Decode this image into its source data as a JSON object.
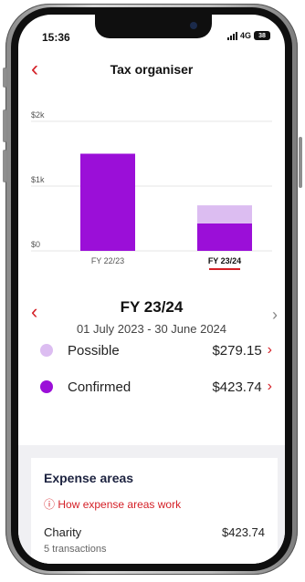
{
  "status_bar": {
    "time": "15:36",
    "network": "4G",
    "battery": "38"
  },
  "header": {
    "title": "Tax organiser",
    "back_icon": "chevron-left-icon"
  },
  "chart_data": {
    "type": "bar",
    "categories": [
      "FY 22/23",
      "FY 23/24"
    ],
    "series": [
      {
        "name": "Confirmed",
        "values": [
          1500,
          423.74
        ]
      },
      {
        "name": "Possible",
        "values": [
          0,
          279.15
        ]
      }
    ],
    "y_ticks": [
      "$0",
      "$1k",
      "$2k"
    ],
    "ylim": [
      0,
      2000
    ],
    "selected_category": "FY 23/24",
    "colors": {
      "confirmed": "#9b0fd8",
      "possible": "#dcbdf1",
      "grid": "#e6e6e6"
    }
  },
  "period": {
    "title": "FY 23/24",
    "range": "01 July 2023 - 30 June 2024"
  },
  "summary": [
    {
      "label": "Possible",
      "amount": "$279.15",
      "color": "#dcbdf1"
    },
    {
      "label": "Confirmed",
      "amount": "$423.74",
      "color": "#9b0fd8"
    }
  ],
  "expenses": {
    "title": "Expense areas",
    "help_link": "How expense areas work",
    "items": [
      {
        "name": "Charity",
        "amount": "$423.74",
        "detail": "5 transactions"
      }
    ]
  }
}
